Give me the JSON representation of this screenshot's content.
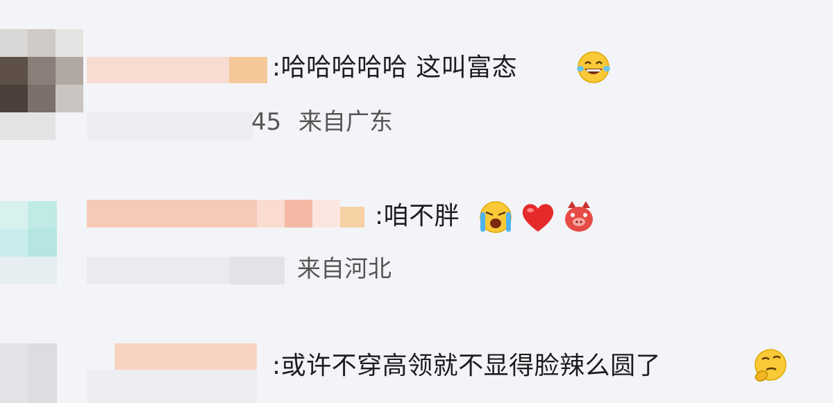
{
  "comments": [
    {
      "text": ":哈哈哈哈哈 这叫富态",
      "meta_prefix": "45",
      "location": "来自广东",
      "emojis": [
        "laughing-tears-emoji"
      ]
    },
    {
      "text": ":咱不胖",
      "meta_prefix": "",
      "location": "来自河北",
      "emojis": [
        "crying-emoji",
        "red-heart-emoji",
        "piggy-emoji"
      ]
    },
    {
      "text": ":或许不穿高领就不显得脸辣么圆了",
      "meta_prefix": "",
      "location": "",
      "emojis": [
        "thinking-emoji"
      ]
    }
  ],
  "colors": {
    "background": "#f3f4f7",
    "text": "#1d1d1f",
    "meta": "#555555",
    "blur_peach": "#f7c9b7",
    "heart": "#e42a2a",
    "emoji_yellow": "#f9c938"
  }
}
